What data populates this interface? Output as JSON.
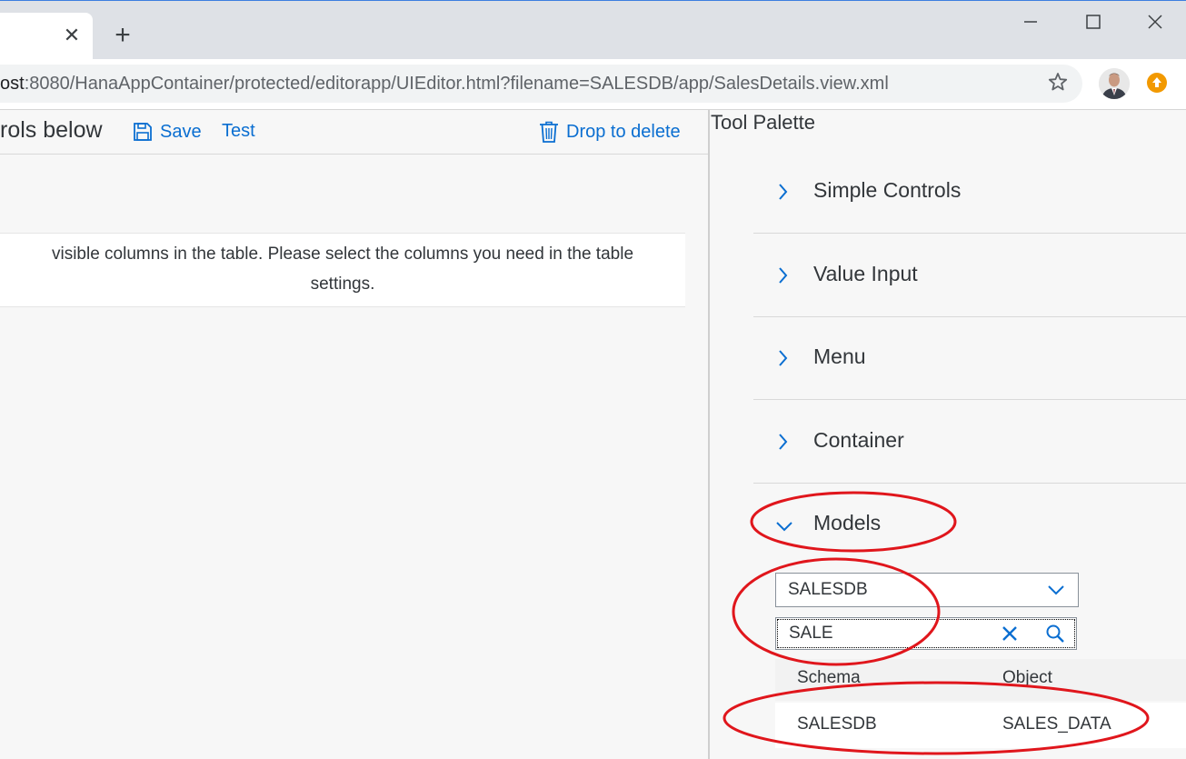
{
  "browser": {
    "tab_close_glyph": "✕",
    "new_tab_glyph": "+",
    "url_prefix": "ost",
    "url_rest": ":8080/HanaAppContainer/protected/editorapp/UIEditor.html?filename=SALESDB/app/SalesDetails.view.xml"
  },
  "editor": {
    "toolbar_title": "rols below",
    "save_label": "Save",
    "test_label": "Test",
    "delete_label": "Drop to delete",
    "notice_line1": " visible columns in the table. Please select the columns you need in the table",
    "notice_line2": "settings."
  },
  "palette": {
    "title": "Tool Palette",
    "sections": [
      "Simple Controls",
      "Value Input",
      "Menu",
      "Container"
    ],
    "models_label": "Models",
    "model_select_value": "SALESDB",
    "search_value": "SALE",
    "table_headers": [
      "Schema",
      "Object"
    ],
    "rows": [
      {
        "schema": "SALESDB",
        "object": "SALES_DATA"
      }
    ]
  },
  "colors": {
    "accent": "#0a6ed1",
    "annotation": "#e0161c",
    "tabstrip": "#dee1e6",
    "panel_bg": "#f7f7f7"
  }
}
